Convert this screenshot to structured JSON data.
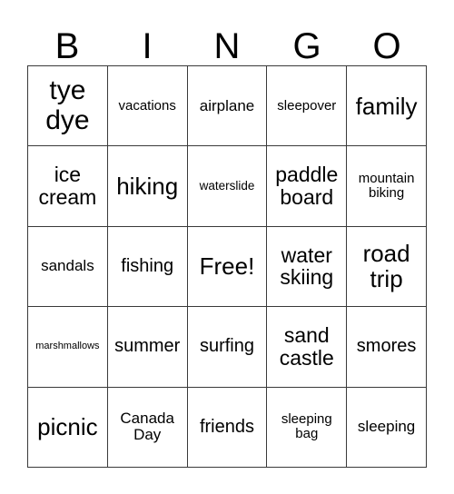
{
  "card": {
    "type": "bingo-card",
    "columns": 5,
    "rows": 5,
    "background_color": "#ffffff",
    "text_color": "#000000",
    "grid_line_color": "#3a3a3a"
  },
  "header": {
    "letters": [
      "B",
      "I",
      "N",
      "G",
      "O"
    ]
  },
  "grid": {
    "cells": [
      {
        "text": "tye dye",
        "size": "fs-xxl",
        "free": false
      },
      {
        "text": "vacations",
        "size": "fs-xs",
        "free": false
      },
      {
        "text": "airplane",
        "size": "fs-sm",
        "free": false
      },
      {
        "text": "sleepover",
        "size": "fs-xs",
        "free": false
      },
      {
        "text": "family",
        "size": "fs-xl",
        "free": false
      },
      {
        "text": "ice cream",
        "size": "fs-lg",
        "free": false
      },
      {
        "text": "hiking",
        "size": "fs-xl",
        "free": false
      },
      {
        "text": "waterslide",
        "size": "fs-xxs",
        "free": false
      },
      {
        "text": "paddle board",
        "size": "fs-lg",
        "free": false
      },
      {
        "text": "mountain biking",
        "size": "fs-xs",
        "free": false
      },
      {
        "text": "sandals",
        "size": "fs-sm",
        "free": false
      },
      {
        "text": "fishing",
        "size": "fs-md",
        "free": false
      },
      {
        "text": "Free!",
        "size": "fs-xl",
        "free": true
      },
      {
        "text": "water skiing",
        "size": "fs-lg",
        "free": false
      },
      {
        "text": "road trip",
        "size": "fs-xl",
        "free": false
      },
      {
        "text": "marshmallows",
        "size": "fs-tiny",
        "free": false
      },
      {
        "text": "summer",
        "size": "fs-md",
        "free": false
      },
      {
        "text": "surfing",
        "size": "fs-md",
        "free": false
      },
      {
        "text": "sand castle",
        "size": "fs-lg",
        "free": false
      },
      {
        "text": "smores",
        "size": "fs-md",
        "free": false
      },
      {
        "text": "picnic",
        "size": "fs-xl",
        "free": false
      },
      {
        "text": "Canada Day",
        "size": "fs-sm",
        "free": false
      },
      {
        "text": "friends",
        "size": "fs-md",
        "free": false
      },
      {
        "text": "sleeping bag",
        "size": "fs-xs",
        "free": false
      },
      {
        "text": "sleeping",
        "size": "fs-sm",
        "free": false
      }
    ]
  }
}
